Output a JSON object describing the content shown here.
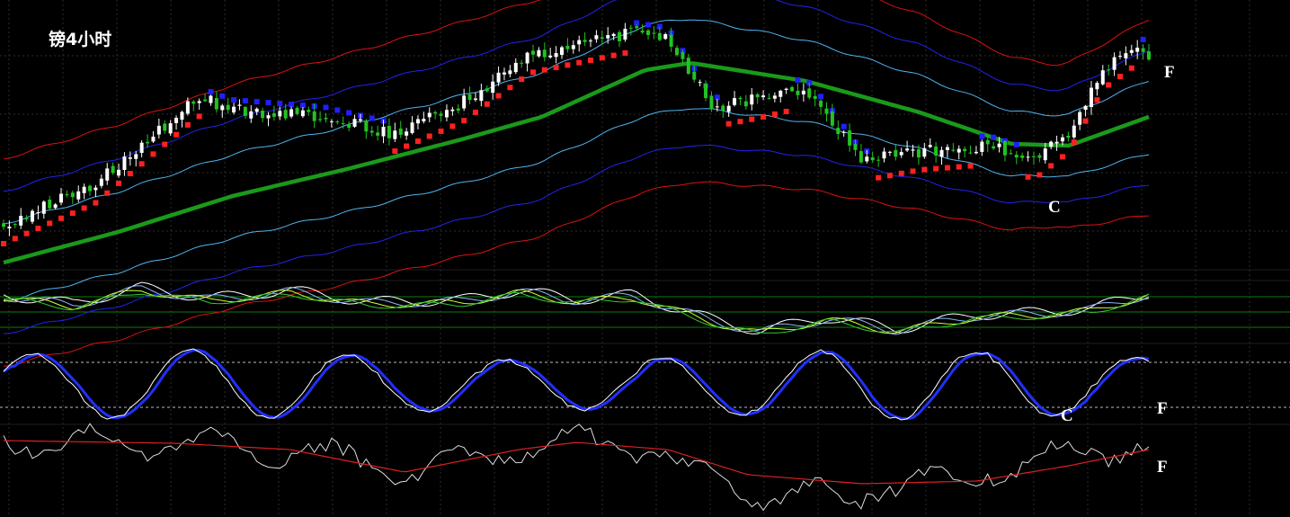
{
  "chart_data": {
    "type": "candlestick",
    "title": "镑4小时",
    "panels": [
      {
        "name": "price",
        "series": [
          {
            "key": "candles",
            "kind": "candlestick",
            "up_color": "#ffffff",
            "down_color": "#22c322"
          },
          {
            "key": "middle",
            "kind": "line",
            "color": "#1a9a1a"
          },
          {
            "key": "inner_band",
            "kind": "line",
            "color": "#4fb3ef"
          },
          {
            "key": "mid_band",
            "kind": "line",
            "color": "#2222ee"
          },
          {
            "key": "outer_band",
            "kind": "line",
            "color": "#dd1111"
          },
          {
            "key": "trend_dots",
            "kind": "dots",
            "up_color": "#ff2020",
            "down_color": "#2020ff"
          }
        ],
        "annotations": [
          {
            "text": "F",
            "at": "last-bar"
          },
          {
            "text": "C",
            "at": "swing-low"
          }
        ]
      },
      {
        "name": "oscillator-1",
        "series": [
          {
            "key": "osc_a",
            "kind": "line",
            "color": "#ffffff"
          },
          {
            "key": "osc_b",
            "kind": "line",
            "color": "#8fb3ff"
          },
          {
            "key": "osc_c",
            "kind": "line",
            "color": "#ccff33"
          },
          {
            "key": "osc_d",
            "kind": "line",
            "color": "#33cc33"
          }
        ],
        "levels": {
          "color": "#0f7a0f",
          "count": 3
        }
      },
      {
        "name": "stochastic",
        "series": [
          {
            "key": "k",
            "kind": "line",
            "color": "#ffffff"
          },
          {
            "key": "d",
            "kind": "line",
            "color": "#2030ff"
          }
        ],
        "levels": {
          "values": [
            80,
            20
          ],
          "style": "dashed",
          "color": "#bbbbbb"
        },
        "annotations": [
          {
            "text": "C",
            "at": "swing-low"
          },
          {
            "text": "F",
            "at": "last-bar"
          }
        ]
      },
      {
        "name": "oscillator-2",
        "series": [
          {
            "key": "raw",
            "kind": "line",
            "color": "#dddddd"
          },
          {
            "key": "signal",
            "kind": "line",
            "color": "#dd2020"
          }
        ],
        "annotations": [
          {
            "text": "F",
            "at": "last-bar"
          }
        ]
      }
    ],
    "grid": true,
    "background": "#000000",
    "bars_approx": 200
  }
}
